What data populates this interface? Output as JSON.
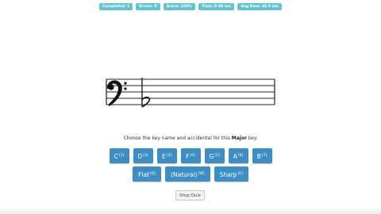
{
  "stats": {
    "completed": "Completed: 1",
    "errors": "Errors: 0",
    "score": "Score: 100%",
    "time": "Time: 9.98 sec",
    "avg_time": "Avg time: 44.0 sec"
  },
  "staff": {
    "clef": "bass-clef",
    "accidental": "flat"
  },
  "prompt": {
    "before": "Choose the key name and accidental for this ",
    "key_type": "Major",
    "after": " key."
  },
  "notes": [
    {
      "label": "C",
      "shortcut": "[1]"
    },
    {
      "label": "D",
      "shortcut": "[2]"
    },
    {
      "label": "E",
      "shortcut": "[3]"
    },
    {
      "label": "F",
      "shortcut": "[4]"
    },
    {
      "label": "G",
      "shortcut": "[5]"
    },
    {
      "label": "A",
      "shortcut": "[6]"
    },
    {
      "label": "B",
      "shortcut": "[7]"
    }
  ],
  "accidentals": [
    {
      "label": "Flat",
      "shortcut": "[Q]"
    },
    {
      "label": "(Natural)",
      "shortcut": "[W]"
    },
    {
      "label": "Sharp",
      "shortcut": "[E]"
    }
  ],
  "stop_label": "Stop Quiz",
  "colors": {
    "stat_badge": "#63c3d3",
    "button": "#3d8fc3"
  }
}
